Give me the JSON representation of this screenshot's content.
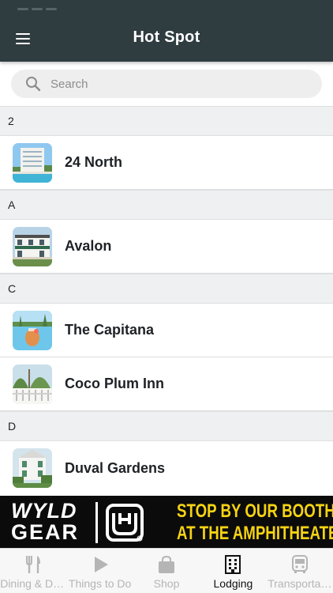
{
  "header": {
    "title": "Hot Spot"
  },
  "search": {
    "placeholder": "Search"
  },
  "list": {
    "sections": [
      {
        "letter": "2",
        "items": [
          "24 North"
        ]
      },
      {
        "letter": "A",
        "items": [
          "Avalon"
        ]
      },
      {
        "letter": "C",
        "items": [
          "The Capitana",
          "Coco Plum Inn"
        ]
      },
      {
        "letter": "D",
        "items": [
          "Duval Gardens"
        ]
      }
    ]
  },
  "ad": {
    "brand_line1": "WYLD",
    "brand_line2": "GEAR",
    "message_line1": "STOP BY OUR BOOTH",
    "message_line2": "AT THE AMPHITHEATER",
    "accent_color": "#f6d313"
  },
  "tabbar": {
    "active_index": 3,
    "tabs": [
      {
        "label": "Dining & Drinks",
        "display": "Dining & Dr…",
        "icon": "fork-knife-icon"
      },
      {
        "label": "Things to Do",
        "display": "Things to Do",
        "icon": "play-icon"
      },
      {
        "label": "Shop",
        "display": "Shop",
        "icon": "shopping-bag-icon"
      },
      {
        "label": "Lodging",
        "display": "Lodging",
        "icon": "building-icon"
      },
      {
        "label": "Transportation",
        "display": "Transporta…",
        "icon": "bus-icon"
      }
    ]
  },
  "colors": {
    "header_bg": "#2f3c40",
    "section_bg": "#eef0f2",
    "tab_inactive": "#b5b5b5",
    "tab_active": "#111111"
  }
}
